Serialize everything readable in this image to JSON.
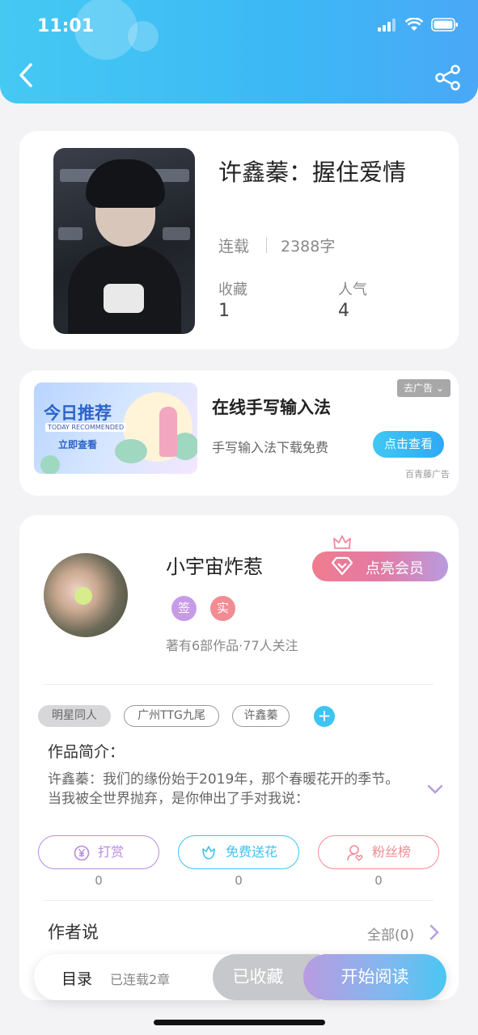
{
  "status_bar": {
    "time": "11:01"
  },
  "header": {
    "back_icon": "chevron-left-icon",
    "share_icon": "share-icon"
  },
  "book": {
    "title": "许鑫蓁：握住爱情",
    "status": "连载",
    "word_count": "2388字",
    "stats": [
      {
        "label": "收藏",
        "value": "1"
      },
      {
        "label": "人气",
        "value": "4"
      }
    ]
  },
  "ad": {
    "banner_title": "今日推荐",
    "banner_subtitle": "TODAY RECOMMENDED",
    "banner_cta": "立即查看",
    "title": "在线手写输入法",
    "description": "手写输入法下载免费",
    "button": "点击查看",
    "close_label": "去广告",
    "source": "百青藤广告"
  },
  "author": {
    "name": "小宇宙炸惹",
    "badges": [
      {
        "text": "签",
        "color": "#c79be8"
      },
      {
        "text": "实",
        "color": "#f18c93"
      }
    ],
    "meta": "著有6部作品·77人关注",
    "vip_button": "点亮会员"
  },
  "tags": [
    "明星同人",
    "广州TTG九尾",
    "许鑫蓁"
  ],
  "intro": {
    "title": "作品简介：",
    "text": "许鑫蓁：我们的缘份始于2019年，那个春暖花开的季节。当我被全世界抛弃，是你伸出了手对我说："
  },
  "actions": [
    {
      "label": "打赏",
      "count": "0",
      "color": "#b88ce0",
      "icon": "yen-coin-icon"
    },
    {
      "label": "免费送花",
      "count": "0",
      "color": "#3fc3f2",
      "icon": "flower-icon"
    },
    {
      "label": "粉丝榜",
      "count": "0",
      "color": "#f18c93",
      "icon": "fan-user-icon"
    }
  ],
  "author_says": {
    "title": "作者说",
    "link": "全部(0)"
  },
  "bottom_bar": {
    "toc_label": "目录",
    "toc_status": "已连载2章",
    "favorited_label": "已收藏",
    "read_label": "开始阅读"
  }
}
